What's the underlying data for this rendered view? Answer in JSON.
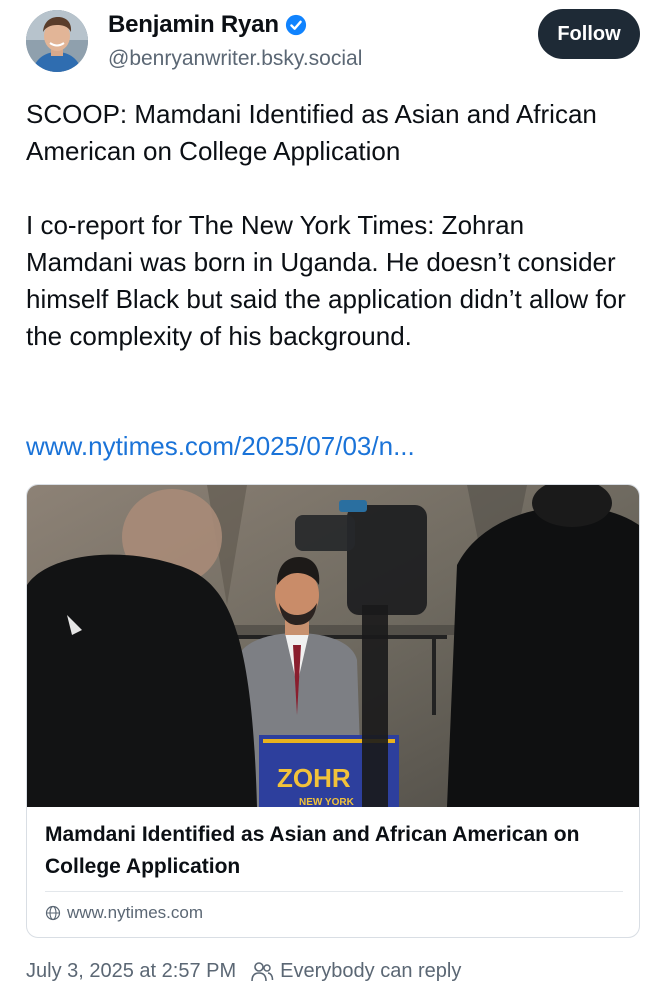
{
  "author": {
    "display_name": "Benjamin Ryan",
    "handle": "@benryanwriter.bsky.social",
    "follow_label": "Follow",
    "verified": true
  },
  "post": {
    "paragraphs": [
      "SCOOP: Mamdani Identified as Asian and African American on College Application",
      "I co-report for The New York Times: Zohran Mamdani was born in Uganda. He doesn’t consider himself Black but said the application didn’t allow for the complexity of his background."
    ],
    "link_text": "www.nytimes.com/2025/07/03/n..."
  },
  "link_card": {
    "title": "Mamdani Identified as Asian and African American on College Application",
    "domain": "www.nytimes.com",
    "image_text": {
      "sign_main": "ZOHR",
      "sign_sub": "NEW YORK"
    }
  },
  "meta": {
    "timestamp": "July 3, 2025 at 2:57 PM",
    "reply_setting": "Everybody can reply"
  },
  "colors": {
    "link": "#1a73d8",
    "follow_button_bg": "#1e2a36",
    "verified_badge": "#1083fe",
    "secondary_text": "#5b6774"
  }
}
